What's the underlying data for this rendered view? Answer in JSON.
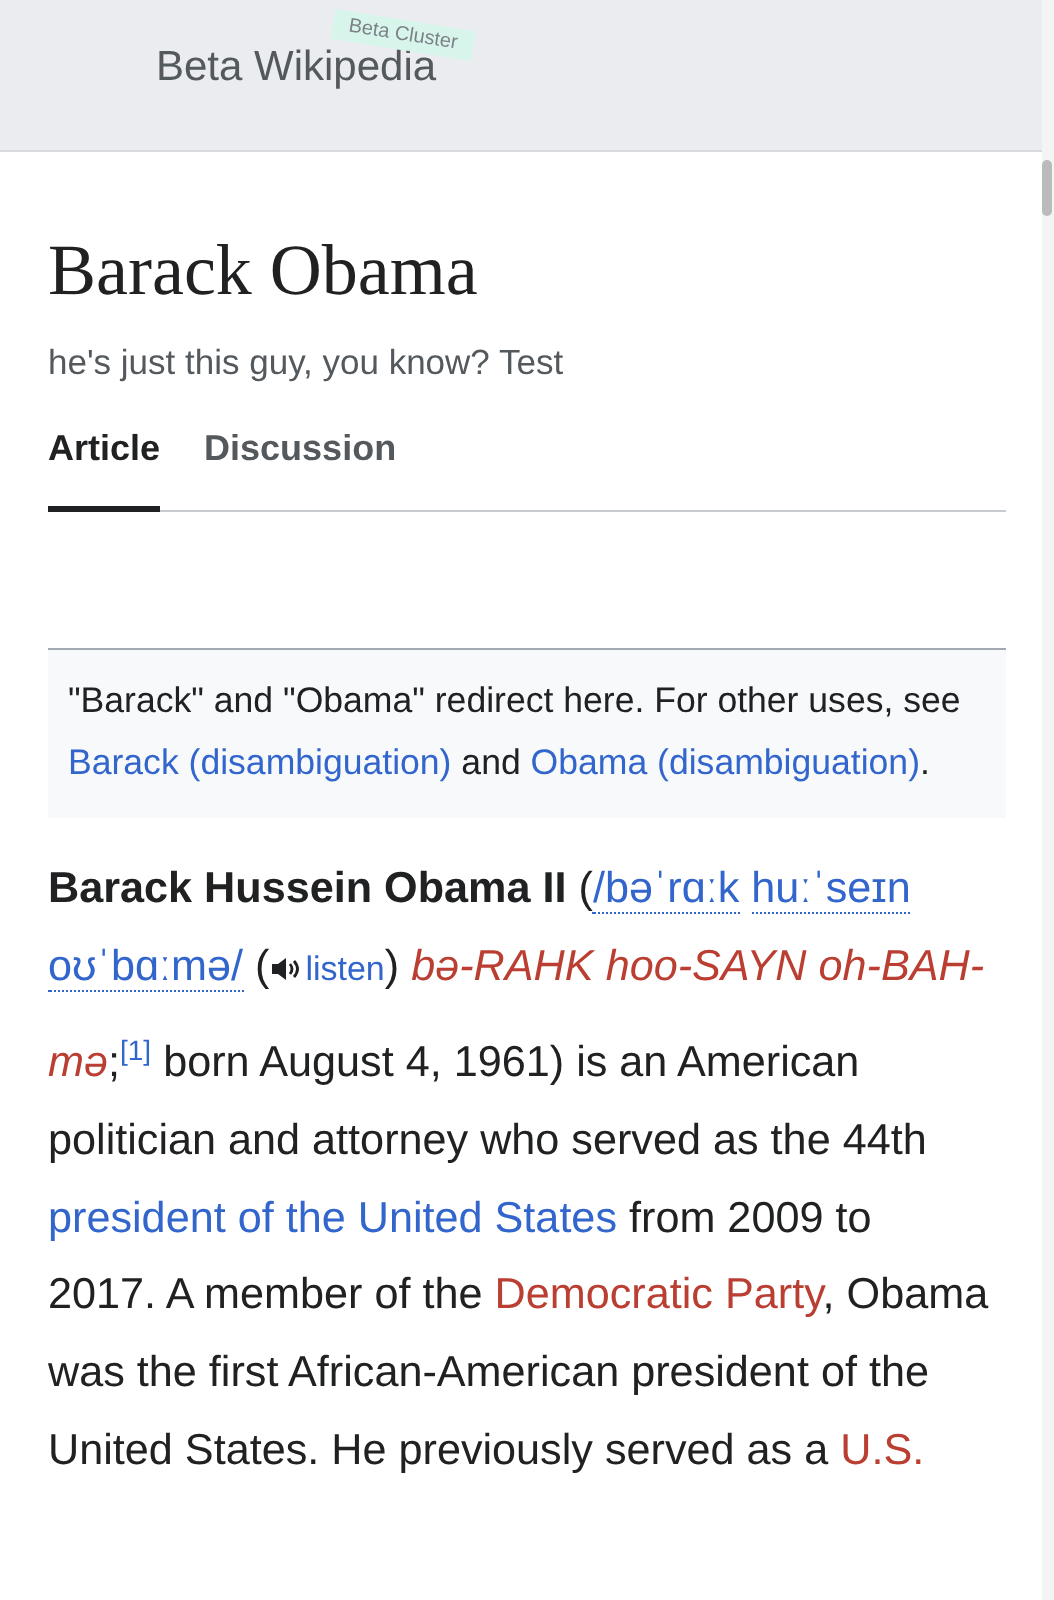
{
  "header": {
    "logo": "Beta Wikipedia",
    "badge": "Beta Cluster"
  },
  "page": {
    "title": "Barack Obama",
    "tagline": "he's just this guy, you know? Test"
  },
  "tabs": [
    {
      "label": "Article",
      "selected": true
    },
    {
      "label": "Discussion",
      "selected": false
    }
  ],
  "hatnote": [
    {
      "kind": "text",
      "text": "\"Barack\" and \"Obama\" redirect here. For other uses, see "
    },
    {
      "kind": "link",
      "text": "Barack (disambiguation)"
    },
    {
      "kind": "text",
      "text": " and "
    },
    {
      "kind": "link",
      "text": "Obama (disambiguation)"
    },
    {
      "kind": "text",
      "text": "."
    }
  ],
  "paragraph": [
    {
      "kind": "bold",
      "text": "Barack Hussein Obama II"
    },
    {
      "kind": "text",
      "text": " ("
    },
    {
      "kind": "ipa",
      "text": "/bəˈrɑːk"
    },
    {
      "kind": "space"
    },
    {
      "kind": "ipa",
      "text": "huːˈseɪn"
    },
    {
      "kind": "space"
    },
    {
      "kind": "ipa",
      "text": "oʊˈbɑːmə/"
    },
    {
      "kind": "space"
    },
    {
      "kind": "text",
      "text": "("
    },
    {
      "kind": "audio",
      "text": "listen"
    },
    {
      "kind": "text",
      "text": ")"
    },
    {
      "kind": "space"
    },
    {
      "kind": "respell",
      "text": "bə-RAHK"
    },
    {
      "kind": "space"
    },
    {
      "kind": "respell",
      "text": "hoo-SAYN"
    },
    {
      "kind": "space"
    },
    {
      "kind": "respell",
      "text": "oh-"
    },
    {
      "kind": "respell",
      "text": "BAH-mə"
    },
    {
      "kind": "text",
      "text": ";"
    },
    {
      "kind": "ref",
      "text": "[1]"
    },
    {
      "kind": "text",
      "text": " born August 4, 1961) is an American politician and attorney who served as the 44th "
    },
    {
      "kind": "link",
      "text": "president of the United States"
    },
    {
      "kind": "text",
      "text": " from 2009 to 2017. A member of the "
    },
    {
      "kind": "redlink",
      "text": "Democratic Party"
    },
    {
      "kind": "text",
      "text": ", Obama was the first African-American president of the United States. He previously served as a "
    },
    {
      "kind": "redlink",
      "text": "U.S."
    }
  ]
}
